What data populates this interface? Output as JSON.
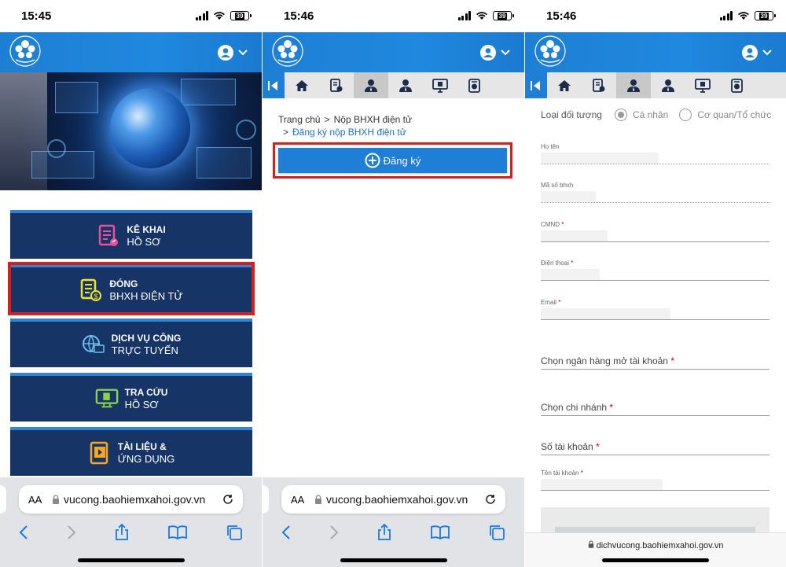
{
  "panel1": {
    "status": {
      "time": "15:45",
      "battery": "39"
    },
    "menu": [
      {
        "line1": "KÊ KHAI",
        "line2": "HỒ SƠ",
        "icon": "document-edit-icon",
        "color": "#e8509a"
      },
      {
        "line1": "ĐÓNG",
        "line2": "BHXH ĐIỆN TỬ",
        "icon": "money-document-icon",
        "color": "#f2e32a"
      },
      {
        "line1": "DỊCH VỤ CÔNG",
        "line2": "TRỰC TUYẾN",
        "icon": "globe-online-icon",
        "color": "#6cc0f0"
      },
      {
        "line1": "TRA CỨU",
        "line2": "HỒ SƠ",
        "icon": "monitor-search-icon",
        "color": "#8fd14a"
      },
      {
        "line1": "TÀI LIỆU &",
        "line2": "ỨNG DỤNG",
        "icon": "media-book-icon",
        "color": "#f5a623"
      }
    ],
    "safari": {
      "aa": "AA",
      "url": "vucong.baohiemxahoi.gov.vn"
    }
  },
  "panel2": {
    "status": {
      "time": "15:46",
      "battery": "39"
    },
    "breadcrumb": {
      "home": "Trang chủ",
      "level1": "Nộp BHXH điện tử",
      "level2": "Đăng ký nộp BHXH điện tử",
      "sep": ">"
    },
    "register_button": "Đăng ký",
    "safari": {
      "aa": "AA",
      "url": "vucong.baohiemxahoi.gov.vn"
    }
  },
  "panel3": {
    "status": {
      "time": "15:46",
      "battery": "39"
    },
    "subject_type": {
      "label": "Loại đối tượng",
      "option1": "Cá nhân",
      "option2": "Cơ quan/Tổ chức"
    },
    "fields": {
      "name": "Họ tên",
      "bhxh": "Mã số bhxh",
      "cmnd": "CMND",
      "phone": "Điện thoại",
      "email": "Email",
      "bank": "Chọn ngân hàng mở tài khoản",
      "branch": "Chọn chi nhánh",
      "account_no": "Số tài khoản",
      "account_name": "Tên tài khoản",
      "required_mark": "*"
    },
    "bottom_url": "dichvucong.baohiemxahoi.gov.vn"
  },
  "colors": {
    "header_blue": "#1f82d8",
    "menu_navy": "#173467",
    "highlight_red": "#d22020"
  }
}
